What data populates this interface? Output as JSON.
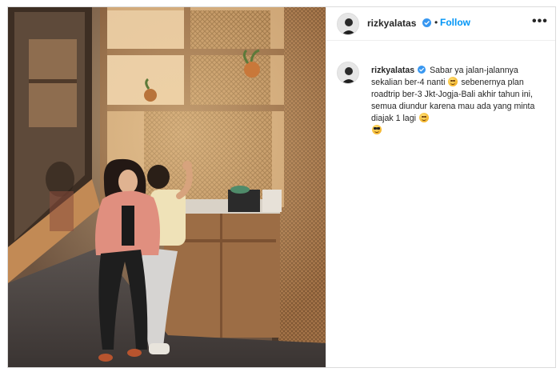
{
  "post": {
    "username": "rizkyalatas",
    "follow_label": "Follow",
    "separator": "•",
    "more_label": "•••",
    "caption_parts": [
      "Sabar ya jalan-jalannya sekalian ber-4 nanti",
      "sebenernya plan roadtrip ber-3 Jkt-Jogja-Bali akhir tahun ini, semua diundur karena mau ada yang minta diajak 1 lagi"
    ],
    "emojis": [
      "rolling-on-floor-laughing",
      "winking-tongue",
      "smiling-face-with-sunglasses"
    ]
  },
  "colors": {
    "follow_blue": "#0095f6",
    "verified_blue": "#3897f0",
    "text": "#262626",
    "border": "#dbdbdb"
  }
}
